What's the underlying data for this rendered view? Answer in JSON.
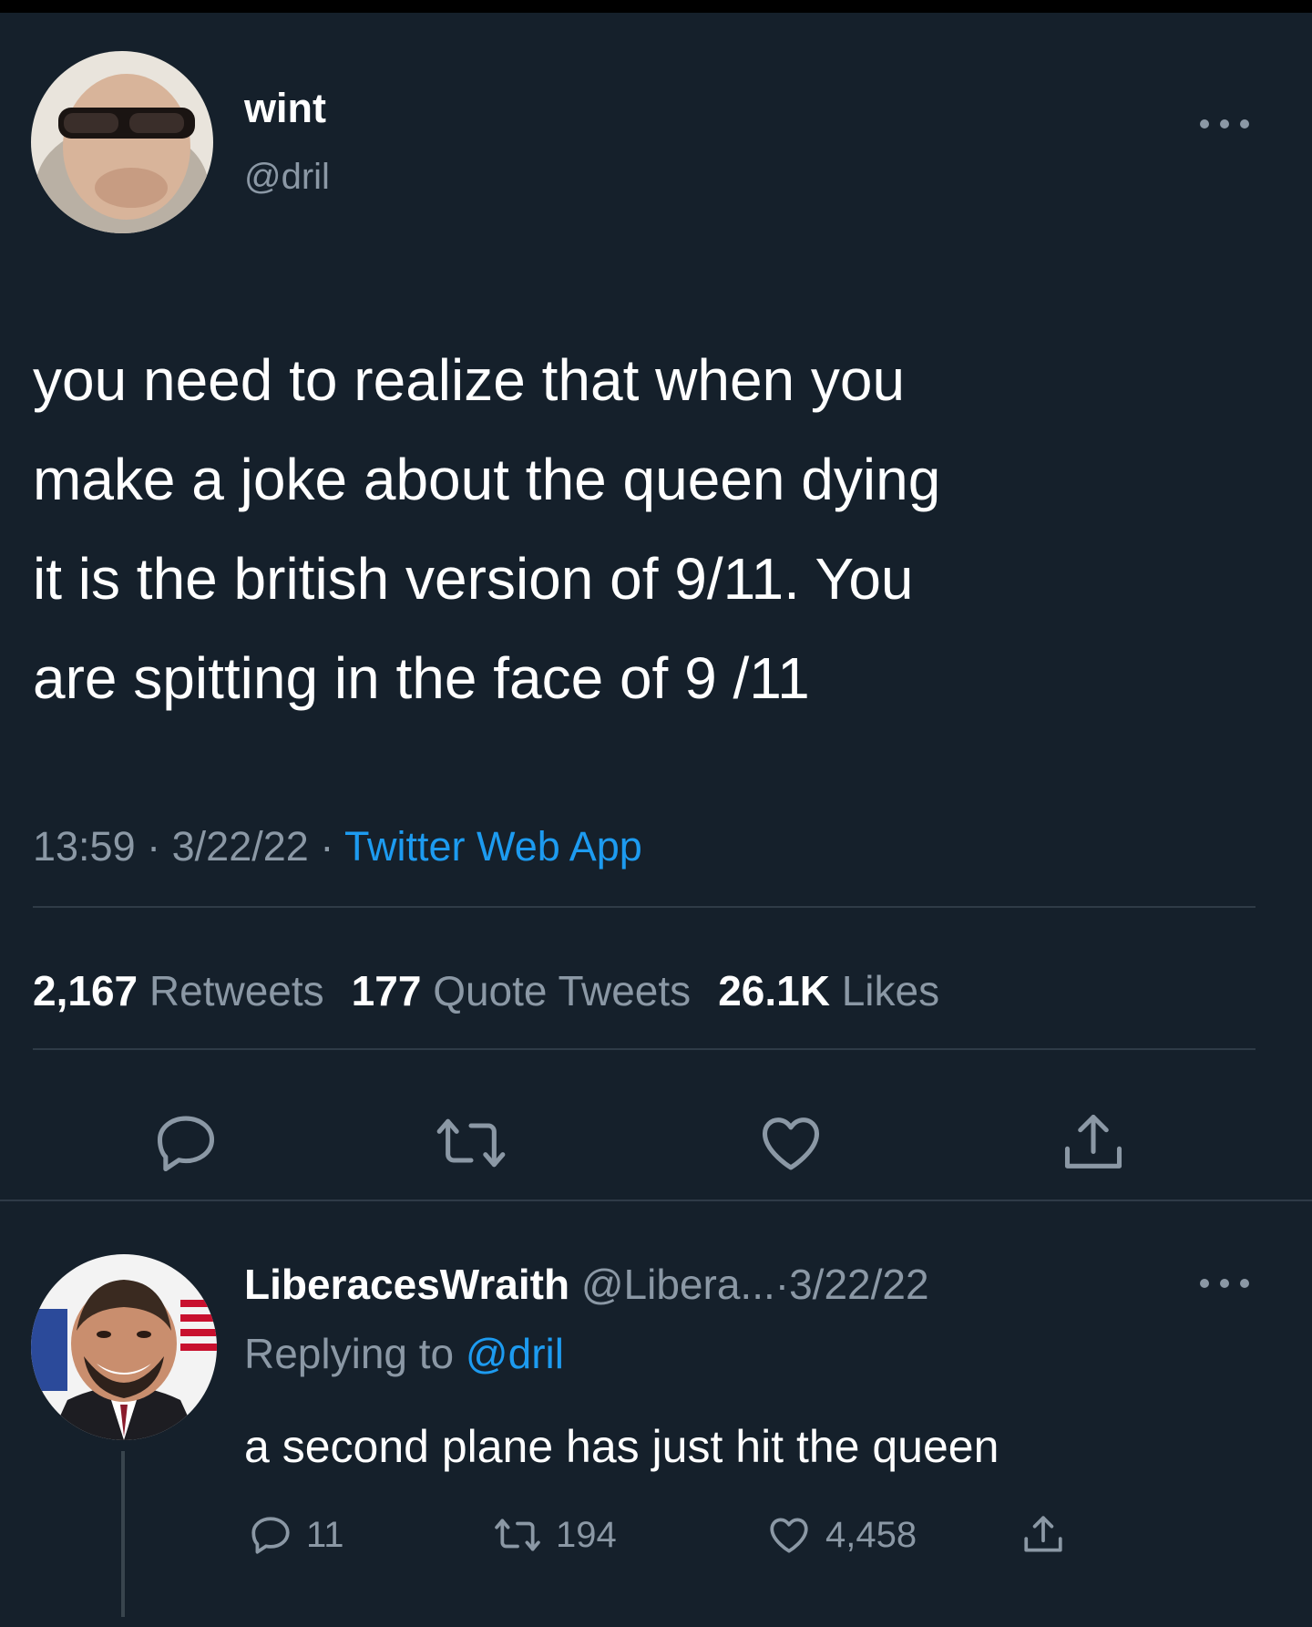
{
  "colors": {
    "background": "#15202b",
    "text": "#ffffff",
    "secondary_text": "#8b98a5",
    "link": "#1d9bf0",
    "divider": "#2f3b47"
  },
  "tweet": {
    "display_name": "wint",
    "handle": "@dril",
    "more_icon": "more-horizontal-icon",
    "text_lines": [
      "you need to realize that when you",
      "make a joke about the queen dying",
      "it is the british version of 9/11. You",
      "are spitting in the face of 9 /11"
    ],
    "time": "13:59",
    "separator": "·",
    "date": "3/22/22",
    "source": "Twitter Web App",
    "stats": {
      "retweets_count": "2,167",
      "retweets_label": "Retweets",
      "quote_tweets_count": "177",
      "quote_tweets_label": "Quote Tweets",
      "likes_count": "26.1K",
      "likes_label": "Likes"
    },
    "actions": [
      "reply-icon",
      "retweet-icon",
      "like-icon",
      "share-icon"
    ]
  },
  "reply": {
    "display_name": "LiberacesWraith",
    "handle": "@Libera...",
    "separator": "·",
    "date": "3/22/22",
    "replying_to_label": "Replying to",
    "replying_to_handle": "@dril",
    "text": "a second plane has just hit the queen",
    "reply_count": "11",
    "retweet_count": "194",
    "like_count": "4,458"
  }
}
